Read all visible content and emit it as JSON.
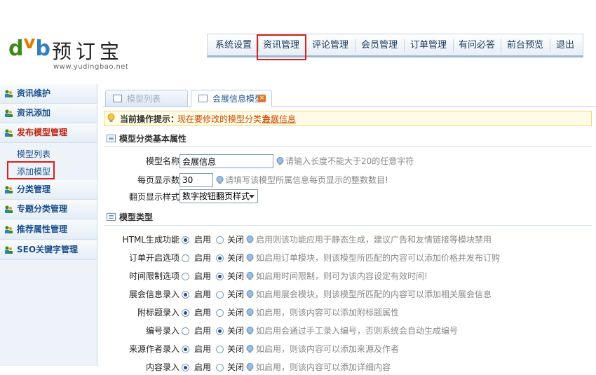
{
  "logo": {
    "mark_d": "d",
    "mark_v": "v",
    "mark_b": "b",
    "brand": "预订宝",
    "url": "www.yudingbao.net"
  },
  "nav": {
    "items": [
      "系统设置",
      "资讯管理",
      "评论管理",
      "会员管理",
      "订单管理",
      "有问必答",
      "前台预览",
      "退出"
    ],
    "highlight_index": 1
  },
  "sidebar": {
    "items": [
      "资讯维护",
      "资讯添加",
      "发布模型管理",
      "分类管理",
      "专题分类管理",
      "推荐属性管理",
      "SEO关键字管理"
    ],
    "active_index": 2,
    "sub_items": [
      "模型列表",
      "添加模型"
    ]
  },
  "tabs": [
    {
      "label": "模型列表",
      "state": "inactive"
    },
    {
      "label": "会展信息模型",
      "state": "active"
    }
  ],
  "tip": {
    "label": "当前操作提示：",
    "text": "现在要修改的模型分类为：",
    "link": "会展信息"
  },
  "basic_section": {
    "title": "模型分类基本属性"
  },
  "basic": {
    "name": {
      "label": "模型名称",
      "value": "会展信息",
      "hint": "请输入长度不能大于20的任意字符"
    },
    "per_page": {
      "label": "每页显示数",
      "value": "30",
      "hint": "请填写该模型所属信息每页显示的整数数目!"
    },
    "paging": {
      "label": "翻页显示样式",
      "selected": "数字按钮翻页样式"
    }
  },
  "type_section": {
    "title": "模型类型"
  },
  "radio_labels": {
    "on": "启用",
    "off": "关闭"
  },
  "types": [
    {
      "label": "HTML生成功能",
      "enabled": true,
      "hint": "启用则该功能应用于静态生成，建议广告和友情链接等模块禁用"
    },
    {
      "label": "订单开启选项",
      "enabled": false,
      "hint": "如启用订单模块，则该模型所匹配的内容可以添加价格并发布订购"
    },
    {
      "label": "时间限制选项",
      "enabled": false,
      "hint": "如启用时间限制，则可为该内容设定有效时间!"
    },
    {
      "label": "展会信息录入",
      "enabled": true,
      "hint": "如启用展会模块，则该模型所匹配的内容可以添加相关展会信息"
    },
    {
      "label": "附标题录入",
      "enabled": true,
      "hint": "如启用，则该内容可以添加附标题属性"
    },
    {
      "label": "编号录入",
      "enabled": false,
      "hint": "如启用会通过手工录入编号，否则系统会自动生成编号"
    },
    {
      "label": "来源作者录入",
      "enabled": true,
      "hint": "如启用，则该内容可以添加来源及作者"
    },
    {
      "label": "内容录入",
      "enabled": true,
      "hint": "如启用，则该内容可以添加详细内容"
    }
  ],
  "colors": {
    "accent": "#1b4f8f",
    "highlight": "#d9201a",
    "tip": "#d04a00"
  }
}
